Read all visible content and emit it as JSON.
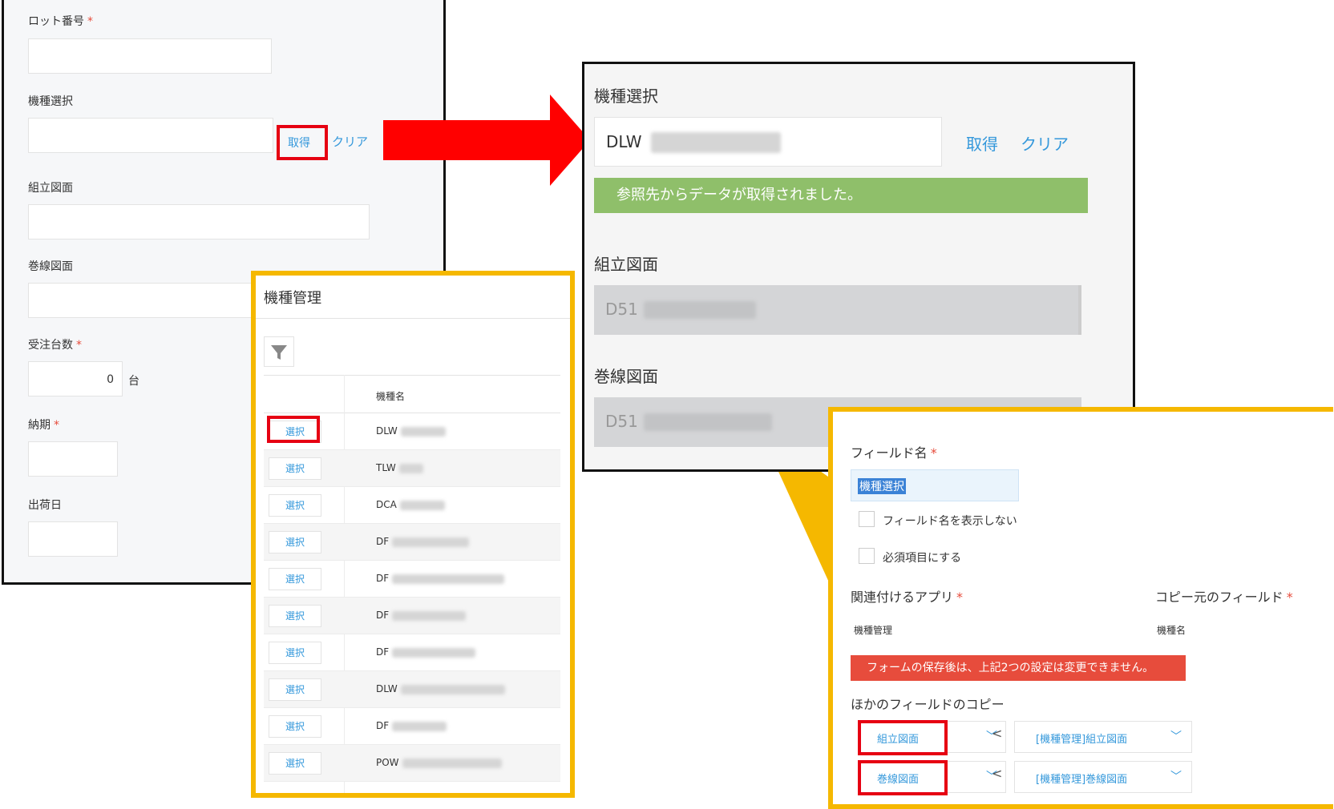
{
  "form": {
    "lot": {
      "label": "ロット番号",
      "req": "*"
    },
    "model": {
      "label": "機種選択",
      "get": "取得",
      "clear": "クリア"
    },
    "assembly": {
      "label": "組立図面"
    },
    "winding": {
      "label": "巻線図面"
    },
    "qty": {
      "label": "受注台数",
      "req": "*",
      "value": "0",
      "unit": "台"
    },
    "due": {
      "label": "納期",
      "req": "*"
    },
    "ship": {
      "label": "出荷日"
    }
  },
  "zoom": {
    "label": "機種選択",
    "value": "DLW",
    "get": "取得",
    "clear": "クリア",
    "success": "参照先からデータが取得されました。",
    "assembly_label": "組立図面",
    "assembly_value": "D51",
    "winding_label": "巻線図面",
    "winding_value": "D51"
  },
  "lookup": {
    "title": "機種管理",
    "column": "機種名",
    "select_label": "選択",
    "rows": [
      {
        "value": "DLW"
      },
      {
        "value": "TLW"
      },
      {
        "value": "DCA"
      },
      {
        "value": "DF"
      },
      {
        "value": "DF"
      },
      {
        "value": "DF"
      },
      {
        "value": "DF"
      },
      {
        "value": "DLW"
      },
      {
        "value": "DF"
      },
      {
        "value": "POW"
      }
    ]
  },
  "settings": {
    "field_name_label": "フィールド名",
    "req": "*",
    "field_name_value": "機種選択",
    "hide_label": "フィールド名を表示しない",
    "required_label": "必須項目にする",
    "app_label": "関連付けるアプリ",
    "app_value": "機種管理",
    "src_label": "コピー元のフィールド",
    "src_value": "機種名",
    "warning": "フォームの保存後は、上記2つの設定は変更できません。",
    "copy_label": "ほかのフィールドのコピー",
    "copies": [
      {
        "to": "組立図面",
        "from": "[機種管理]組立図面"
      },
      {
        "to": "巻線図面",
        "from": "[機種管理]巻線図面"
      }
    ]
  },
  "colors": {
    "accent": "#3498db",
    "callout": "#f5b800",
    "arrow": "#ff0000",
    "success": "#8fbf6a",
    "warning": "#e74c3c",
    "highlight": "#e60012"
  }
}
